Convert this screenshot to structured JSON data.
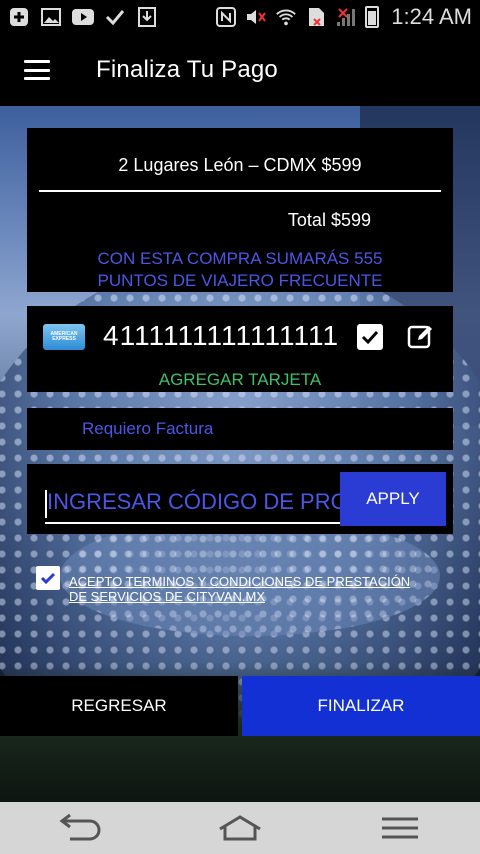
{
  "status_bar": {
    "time": "1:24 AM",
    "icons": [
      "plus-icon",
      "image-icon",
      "youtube-icon",
      "check-icon",
      "download-icon",
      "nfc-icon",
      "mute-icon",
      "wifi-icon",
      "sim-icon",
      "signal-icon",
      "battery-icon"
    ]
  },
  "app_bar": {
    "title": "Finaliza Tu Pago"
  },
  "summary": {
    "trip": "2 Lugares León – CDMX $599",
    "total": "Total $599",
    "points": "CON ESTA COMPRA SUMARÁS 555 PUNTOS DE VIAJERO FRECUENTE"
  },
  "payment": {
    "card_brand_label": "AMERICAN EXPRESS",
    "card_number": "4111111111111111",
    "add_card": "AGREGAR TARJETA"
  },
  "invoice": {
    "label": "Requiero Factura"
  },
  "promo": {
    "placeholder": "INGRESAR CÓDIGO DE PROMOCIÓN",
    "apply": "APPLY"
  },
  "terms": {
    "text": "ACEPTO TERMINOS Y CONDICIONES DE PRESTACIÓN DE SERVICIOS DE CITYVAN.MX"
  },
  "actions": {
    "back": "REGRESAR",
    "finish": "FINALIZAR"
  },
  "colors": {
    "accent_blue": "#1230d4",
    "link_blue": "#4a57e6",
    "green": "#3fbf6a"
  }
}
